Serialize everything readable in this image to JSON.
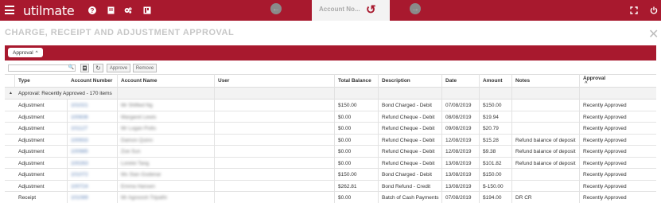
{
  "app": {
    "logo_text": "utilmate",
    "brand_color": "#a8192e"
  },
  "topbar": {
    "icons": [
      "menu-icon",
      "help-icon",
      "book-icon",
      "gears-icon",
      "report-icon",
      "expand-icon",
      "power-icon"
    ],
    "account_search_label": "Account No...",
    "prev_icon": "arrow-left-icon",
    "next_icon": "arrow-right-icon",
    "reset_icon": "undo-icon"
  },
  "page": {
    "title": "CHARGE, RECEIPT AND ADJUSTMENT APPROVAL"
  },
  "grouping": {
    "group_label": "Approval"
  },
  "toolbar": {
    "search_value": "",
    "approve_label": "Approve",
    "remove_label": "Remove"
  },
  "table": {
    "headers": {
      "type": "Type",
      "account_number": "Account Number",
      "account_name": "Account Name",
      "user": "User",
      "total_balance": "Total Balance",
      "description": "Description",
      "date": "Date",
      "amount": "Amount",
      "notes": "Notes",
      "approval": "Approval"
    },
    "group_row": "Approval: Recently Approved - 170 items",
    "rows": [
      {
        "type": "Adjustment",
        "account_number": "101021",
        "account_name": "Mr Shifted Ng",
        "user": "",
        "total_balance": "$150.00",
        "description": "Bond Charged - Debit",
        "date": "07/08/2019",
        "amount": "$150.00",
        "notes": "",
        "approval": "Recently Approved"
      },
      {
        "type": "Adjustment",
        "account_number": "100836",
        "account_name": "Margaret Lewis",
        "user": "",
        "total_balance": "$0.00",
        "description": "Refund Cheque - Debit",
        "date": "08/08/2019",
        "amount": "$19.94",
        "notes": "",
        "approval": "Recently Approved"
      },
      {
        "type": "Adjustment",
        "account_number": "101127",
        "account_name": "Mr Logan Potts",
        "user": "",
        "total_balance": "$0.00",
        "description": "Refund Cheque - Debit",
        "date": "09/08/2019",
        "amount": "$20.79",
        "notes": "",
        "approval": "Recently Approved"
      },
      {
        "type": "Adjustment",
        "account_number": "100933",
        "account_name": "Damon Quinn",
        "user": "",
        "total_balance": "$0.00",
        "description": "Refund Cheque - Debit",
        "date": "12/08/2019",
        "amount": "$15.28",
        "notes": "Refund balance of deposit",
        "approval": "Recently Approved"
      },
      {
        "type": "Adjustment",
        "account_number": "100985",
        "account_name": "Zoe Sun",
        "user": "",
        "total_balance": "$0.00",
        "description": "Refund Cheque - Debit",
        "date": "12/08/2019",
        "amount": "$9.38",
        "notes": "Refund balance of deposit",
        "approval": "Recently Approved"
      },
      {
        "type": "Adjustment",
        "account_number": "100263",
        "account_name": "Lorelei Tang",
        "user": "",
        "total_balance": "$0.00",
        "description": "Refund Cheque - Debit",
        "date": "13/08/2019",
        "amount": "$101.82",
        "notes": "Refund balance of deposit",
        "approval": "Recently Approved"
      },
      {
        "type": "Adjustment",
        "account_number": "101072",
        "account_name": "Ms Sian Godenar",
        "user": "",
        "total_balance": "$150.00",
        "description": "Bond Charged - Debit",
        "date": "13/08/2019",
        "amount": "$150.00",
        "notes": "",
        "approval": "Recently Approved"
      },
      {
        "type": "Adjustment",
        "account_number": "100724",
        "account_name": "Emma Hansen",
        "user": "",
        "total_balance": "$262.81",
        "description": "Bond Refund - Credit",
        "date": "13/08/2019",
        "amount": "$-150.00",
        "notes": "",
        "approval": "Recently Approved"
      },
      {
        "type": "Receipt",
        "account_number": "101089",
        "account_name": "Mr Agnoosh Tripathi",
        "user": "",
        "total_balance": "$0.00",
        "description": "Batch of Cash Payments",
        "date": "07/08/2019",
        "amount": "$194.00",
        "notes": "DR CR",
        "approval": "Recently Approved"
      }
    ]
  }
}
